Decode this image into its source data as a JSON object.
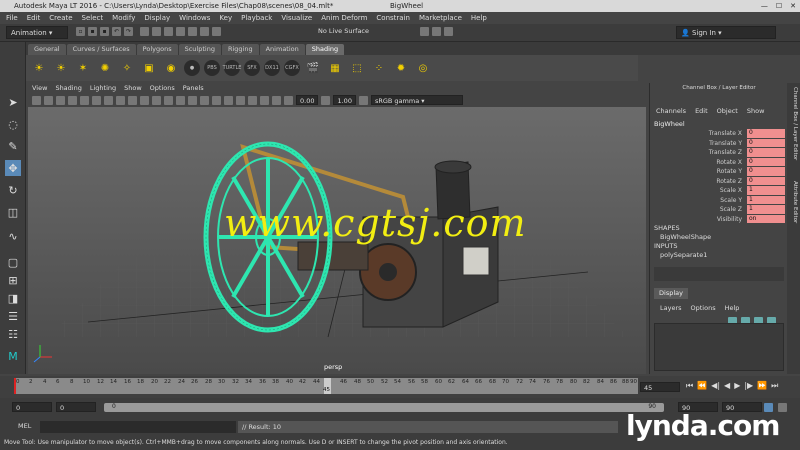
{
  "titlebar": {
    "title": "Autodesk Maya LT 2016 - C:\\Users\\Lynda\\Desktop\\Exercise Files\\Chap08\\scenes\\08_04.mlt*",
    "window_name": "BigWheel",
    "minimize": "—",
    "maximize": "☐",
    "close": "✕"
  },
  "menubar": [
    "File",
    "Edit",
    "Create",
    "Select",
    "Modify",
    "Display",
    "Windows",
    "Key",
    "Playback",
    "Visualize",
    "Anim Deform",
    "Constrain",
    "Marketplace",
    "Help"
  ],
  "statusline": {
    "mode": "Animation",
    "live_surface": "No Live Surface",
    "sign_in": "Sign In"
  },
  "shelf_tabs": [
    "General",
    "Curves / Surfaces",
    "Polygons",
    "Sculpting",
    "Rigging",
    "Animation",
    "Shading"
  ],
  "shelf_labels": {
    "pbs": "PBS",
    "turtle": "TURTLE",
    "sfx": "SFX",
    "dx11": "DX11",
    "cgfx": "CGFX"
  },
  "panel_menu": [
    "View",
    "Shading",
    "Lighting",
    "Show",
    "Options",
    "Panels"
  ],
  "panel_toolbar": {
    "exposure": "0.00",
    "gamma": "1.00",
    "color_space": "sRGB gamma"
  },
  "viewport": {
    "camera": "persp",
    "watermark": "www.cgtsj.com"
  },
  "channel_box": {
    "header": "Channel Box / Layer Editor",
    "menu": [
      "Channels",
      "Edit",
      "Object",
      "Show"
    ],
    "object": "BigWheel",
    "attributes": [
      {
        "name": "Translate X",
        "value": "0"
      },
      {
        "name": "Translate Y",
        "value": "0"
      },
      {
        "name": "Translate Z",
        "value": "0"
      },
      {
        "name": "Rotate X",
        "value": "0"
      },
      {
        "name": "Rotate Y",
        "value": "0"
      },
      {
        "name": "Rotate Z",
        "value": "0"
      },
      {
        "name": "Scale X",
        "value": "1"
      },
      {
        "name": "Scale Y",
        "value": "1"
      },
      {
        "name": "Scale Z",
        "value": "1"
      },
      {
        "name": "Visibility",
        "value": "on"
      }
    ],
    "shapes_label": "SHAPES",
    "shape": "BigWheelShape",
    "inputs_label": "INPUTS",
    "input": "polySeparate1"
  },
  "layer_editor": {
    "tab": "Display",
    "menu": [
      "Layers",
      "Options",
      "Help"
    ]
  },
  "side_tabs": {
    "channel_box": "Channel Box / Layer Editor",
    "attribute_editor": "Attribute Editor"
  },
  "timeline": {
    "ticks": [
      "0",
      "2",
      "4",
      "6",
      "8",
      "10",
      "12",
      "14",
      "16",
      "18",
      "20",
      "22",
      "24",
      "26",
      "28",
      "30",
      "32",
      "34",
      "36",
      "38",
      "40",
      "42",
      "44",
      "46",
      "48",
      "50",
      "52",
      "54",
      "56",
      "58",
      "60",
      "62",
      "64",
      "66",
      "68",
      "70",
      "72",
      "74",
      "76",
      "78",
      "80",
      "82",
      "84",
      "86",
      "88",
      "90"
    ],
    "current_frame": "45",
    "current_frame_field": "45"
  },
  "range": {
    "start": "0",
    "playback_start": "0",
    "slider_start": "0",
    "slider_end": "90",
    "playback_end": "90",
    "end": "90"
  },
  "cmdline": {
    "label": "MEL",
    "result": "// Result: 10"
  },
  "helpline": "Move Tool: Use manipulator to move object(s). Ctrl+MMB+drag to move components along normals. Use D or INSERT to change the pivot position and axis orientation.",
  "brand": "lynda.com"
}
